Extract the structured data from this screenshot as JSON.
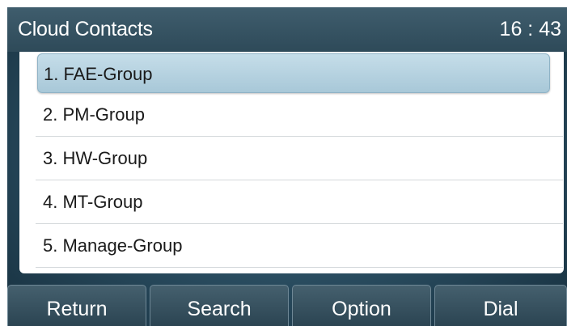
{
  "header": {
    "title": "Cloud Contacts",
    "time": "16 : 43"
  },
  "list": {
    "items": [
      {
        "label": "1. FAE-Group",
        "selected": true
      },
      {
        "label": "2. PM-Group"
      },
      {
        "label": "3. HW-Group"
      },
      {
        "label": "4. MT-Group"
      },
      {
        "label": "5. Manage-Group"
      }
    ]
  },
  "softkeys": {
    "return": "Return",
    "search": "Search",
    "option": "Option",
    "dial": "Dial"
  }
}
